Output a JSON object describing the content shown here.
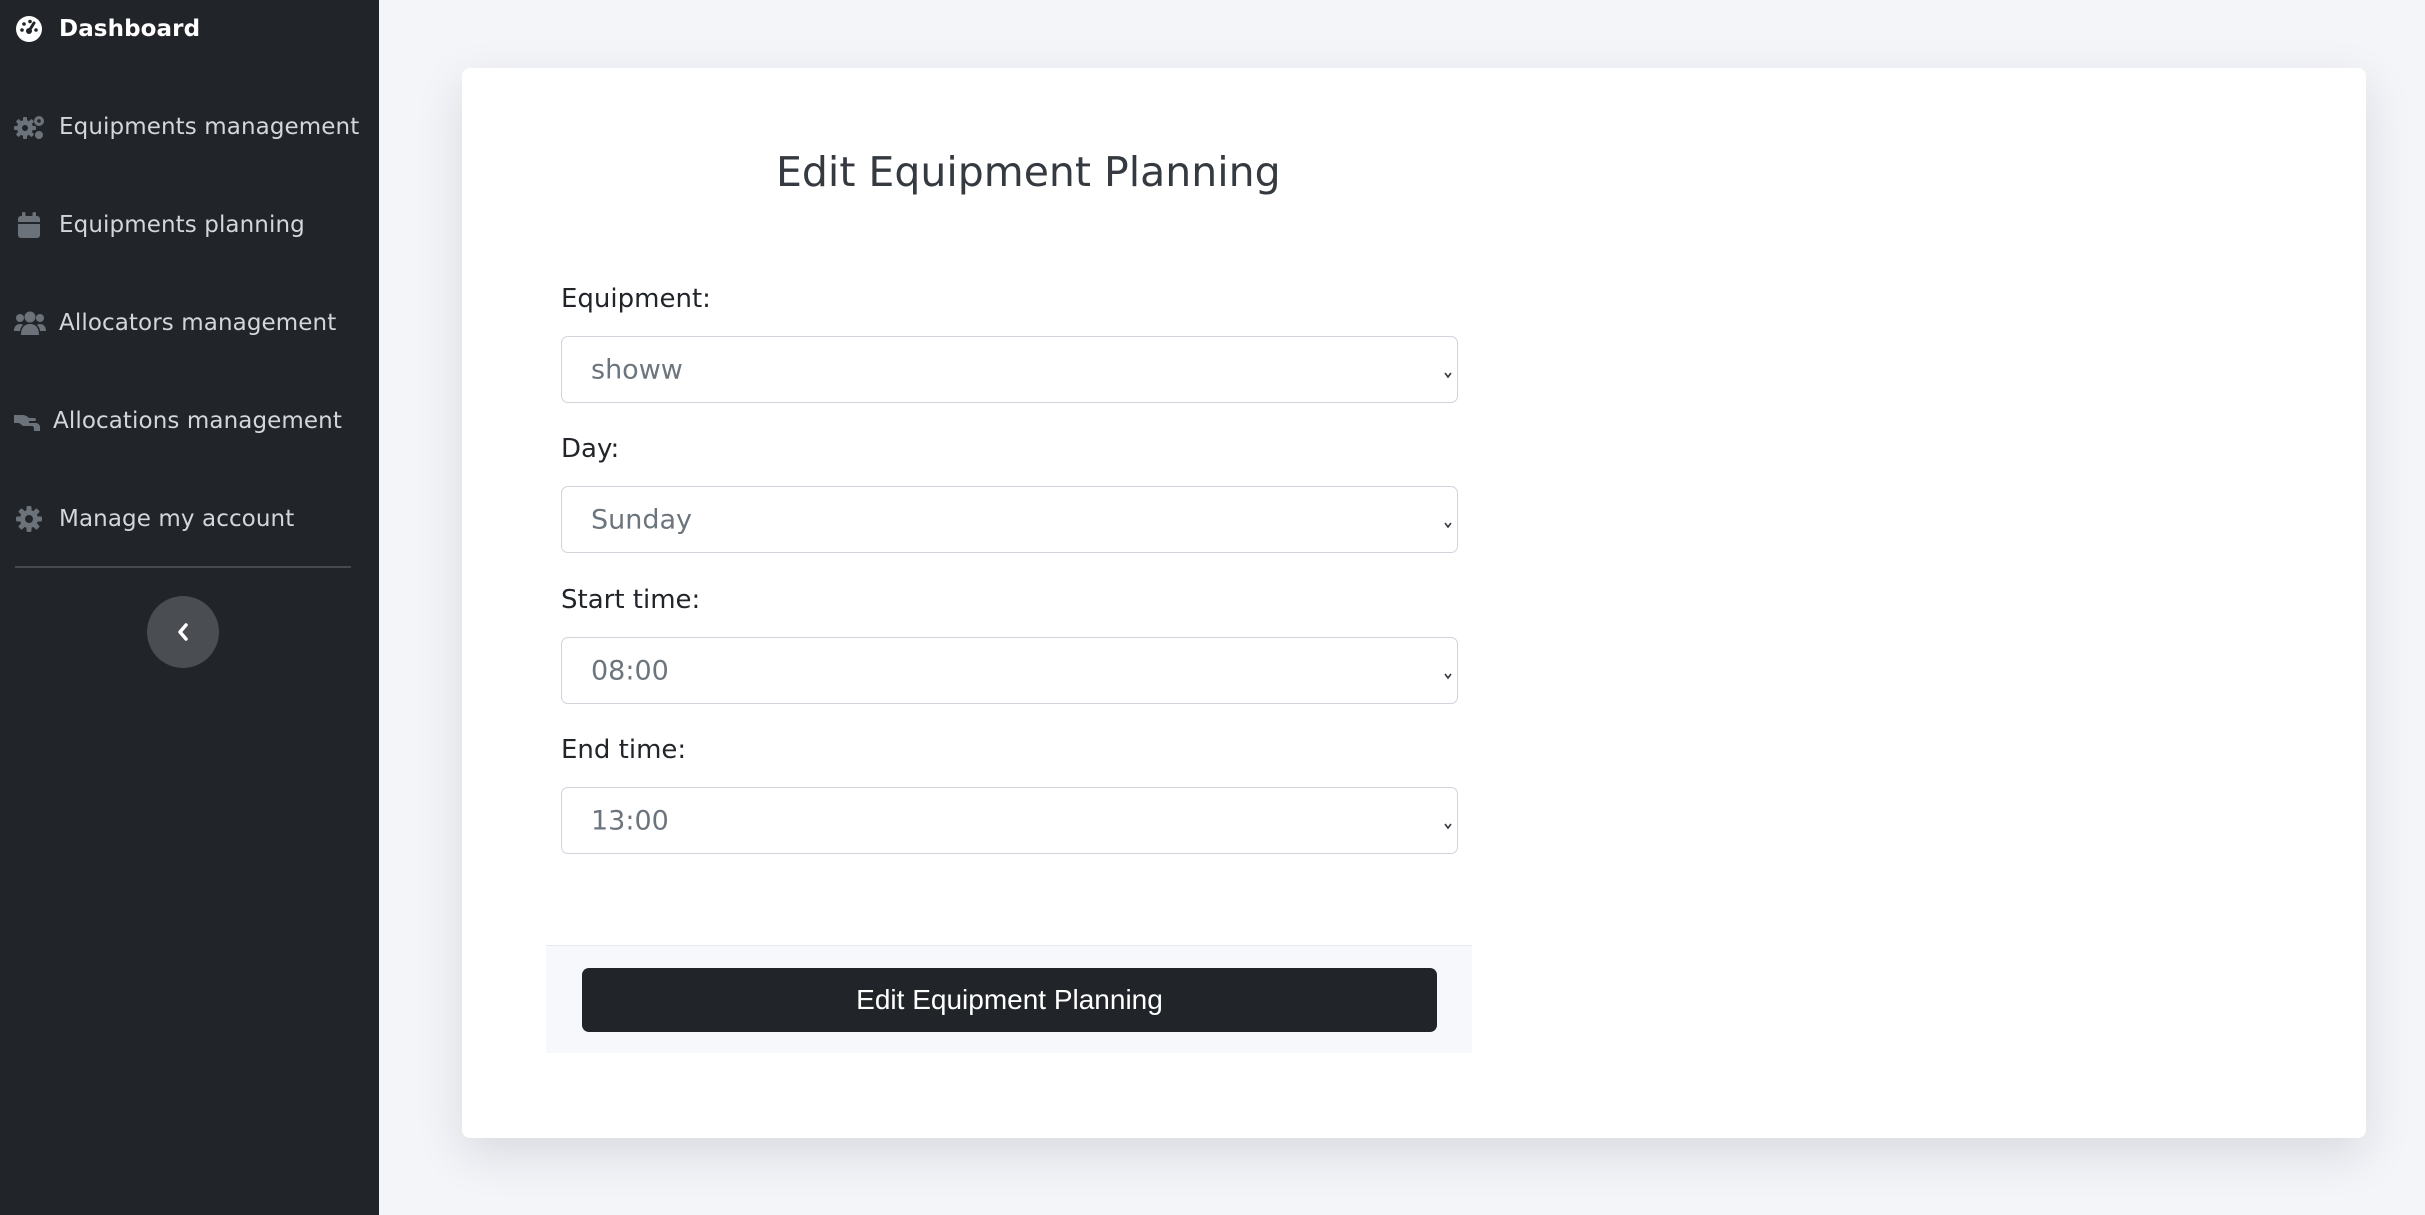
{
  "sidebar": {
    "items": [
      {
        "label": "Dashboard",
        "icon": "gauge-icon",
        "active": true
      },
      {
        "label": "Equipments management",
        "icon": "gears-icon",
        "active": false
      },
      {
        "label": "Equipments planning",
        "icon": "calendar-icon",
        "active": false
      },
      {
        "label": "Allocators management",
        "icon": "users-icon",
        "active": false
      },
      {
        "label": "Allocations management",
        "icon": "hand-holding-icon",
        "active": false
      },
      {
        "label": "Manage my account",
        "icon": "gear-icon",
        "active": false
      }
    ],
    "collapse_icon": "chevron-left-icon"
  },
  "form": {
    "title": "Edit Equipment Planning",
    "fields": [
      {
        "label": "Equipment:",
        "value": "showw"
      },
      {
        "label": "Day:",
        "value": "Sunday"
      },
      {
        "label": "Start time:",
        "value": "08:00"
      },
      {
        "label": "End time:",
        "value": "13:00"
      }
    ],
    "submit_label": "Edit Equipment Planning"
  },
  "colors": {
    "sidebar_bg": "#212529",
    "page_bg": "#f4f5f9",
    "card_bg": "#ffffff",
    "button_bg": "#212529",
    "input_border": "#cfd4da",
    "placeholder_text": "#6c757d"
  }
}
